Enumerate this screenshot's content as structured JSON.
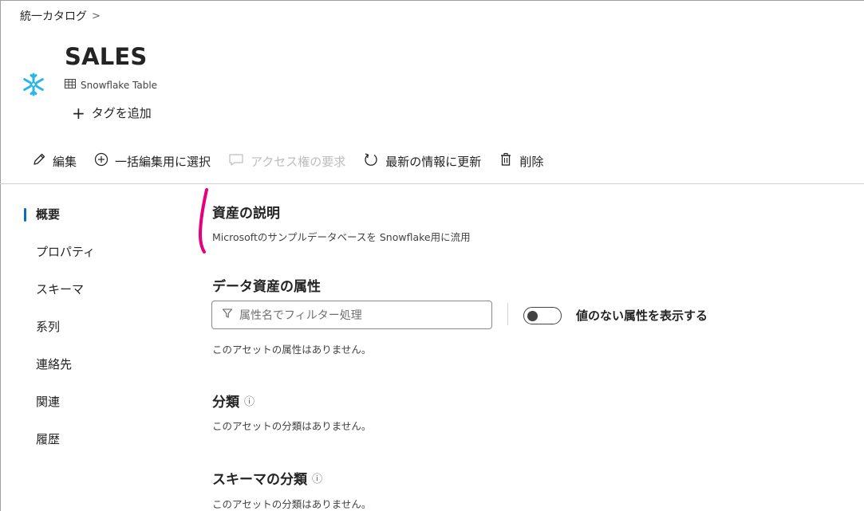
{
  "breadcrumb": {
    "root": "統一カタログ",
    "chevron": ">"
  },
  "asset": {
    "icon": "snowflake-icon",
    "icon_color": "#29B5E8",
    "title": "SALES",
    "type_icon": "table-icon",
    "type_label": "Snowflake Table",
    "add_tag_label": "タグを追加"
  },
  "toolbar": {
    "edit": "編集",
    "bulk_select": "一括編集用に選択",
    "request_access": "アクセス権の要求",
    "refresh": "最新の情報に更新",
    "delete": "削除"
  },
  "sidenav": {
    "active": "概要",
    "items": [
      "概要",
      "プロパティ",
      "スキーマ",
      "系列",
      "連絡先",
      "関連",
      "履歴"
    ]
  },
  "main": {
    "description": {
      "title": "資産の説明",
      "text": "Microsoftのサンプルデータベースを Snowflake用に流用"
    },
    "attributes": {
      "title": "データ資産の属性",
      "filter_placeholder": "属性名でフィルター処理",
      "toggle_label": "値のない属性を表示する",
      "toggle_on": false,
      "empty_text": "このアセットの属性はありません。"
    },
    "classification": {
      "title": "分類",
      "empty_text": "このアセットの分類はありません。"
    },
    "schema_classification": {
      "title": "スキーマの分類",
      "empty_text": "このアセットの分類はありません。"
    }
  },
  "colors": {
    "accent": "#0f6cbd",
    "annotation": "#e6007e",
    "disabled": "#bdbdbd"
  }
}
